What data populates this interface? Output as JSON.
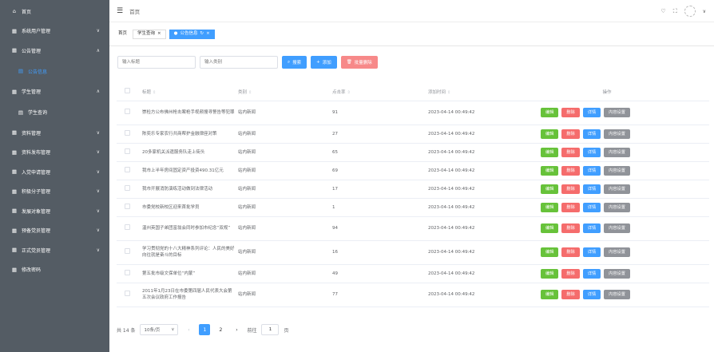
{
  "sidebar": {
    "items": [
      {
        "name": "sidebar-item-home",
        "icon": "⌂",
        "label": "首页",
        "chevron": ""
      },
      {
        "name": "sidebar-item-system-users",
        "icon": "▦",
        "label": "系统用户管理",
        "chevron": "∨"
      },
      {
        "name": "sidebar-item-notice-mgmt",
        "icon": "▦",
        "label": "公告管理",
        "chevron": "∧"
      },
      {
        "name": "sidebar-item-notice-info",
        "icon": "▤",
        "label": "公告信息",
        "chevron": "",
        "sub": true,
        "active": true
      },
      {
        "name": "sidebar-item-student-mgmt",
        "icon": "▦",
        "label": "学生管理",
        "chevron": "∧"
      },
      {
        "name": "sidebar-item-student-query",
        "icon": "▤",
        "label": "学生查询",
        "chevron": "",
        "sub": true
      },
      {
        "name": "sidebar-item-materials",
        "icon": "▦",
        "label": "资料管理",
        "chevron": "∨"
      },
      {
        "name": "sidebar-item-material-publish",
        "icon": "▦",
        "label": "资料发布管理",
        "chevron": "∨"
      },
      {
        "name": "sidebar-item-application",
        "icon": "▦",
        "label": "入党申请管理",
        "chevron": "∨"
      },
      {
        "name": "sidebar-item-activists",
        "icon": "▦",
        "label": "积极分子管理",
        "chevron": "∨"
      },
      {
        "name": "sidebar-item-development",
        "icon": "▦",
        "label": "发展对象管理",
        "chevron": "∨"
      },
      {
        "name": "sidebar-item-probationary",
        "icon": "▦",
        "label": "预备党员管理",
        "chevron": "∨"
      },
      {
        "name": "sidebar-item-full-members",
        "icon": "▦",
        "label": "正式党员管理",
        "chevron": "∨"
      },
      {
        "name": "sidebar-item-change-password",
        "icon": "▦",
        "label": "修改密码",
        "chevron": ""
      }
    ]
  },
  "topbar": {
    "breadcrumb": "首页",
    "hamburger_icon": "☰",
    "icons": [
      "bell-icon",
      "fullscreen-icon"
    ]
  },
  "tags": [
    {
      "label": "首页",
      "active": false,
      "closable": false
    },
    {
      "label": "学生查询",
      "active": false,
      "closable": true
    },
    {
      "label": "公告信息",
      "active": true,
      "closable": true
    }
  ],
  "filters": {
    "title_placeholder": "输入标题",
    "category_placeholder": "输入类别",
    "search_label": "搜索",
    "add_label": "添加",
    "batch_delete_label": "批量删除"
  },
  "table": {
    "headers": {
      "title": "标题",
      "category": "类别",
      "clicks": "点击率",
      "added_time": "添加时间",
      "actions": "操作"
    },
    "action_labels": {
      "edit": "编辑",
      "delete": "删除",
      "detail": "详情",
      "content": "内容设置"
    },
    "rows": [
      {
        "title": "崇检方公布佛州枪击案枪手视频搜寻警告等犯罪",
        "category": "站内新闻",
        "clicks": "91",
        "time": "2023-04-14 00:49:42",
        "tall": true
      },
      {
        "title": "陈奕乐专家农行共商帮护金融律座对策",
        "category": "站内新闻",
        "clicks": "27",
        "time": "2023-04-14 00:49:42",
        "tall": false
      },
      {
        "title": "20多家机关派遣服务队走上街头",
        "category": "站内新闻",
        "clicks": "65",
        "time": "2023-04-14 00:49:42",
        "tall": false
      },
      {
        "title": "我市上半年房间固定资产投资490.31亿元",
        "category": "站内新闻",
        "clicks": "69",
        "time": "2023-04-14 00:49:42",
        "tall": false
      },
      {
        "title": "我市开展消防演练活动做到法律活动",
        "category": "站内新闻",
        "clicks": "17",
        "time": "2023-04-14 00:49:42",
        "tall": false
      },
      {
        "title": "市委党校新校区迎来首批学员",
        "category": "站内新闻",
        "clicks": "1",
        "time": "2023-04-14 00:49:42",
        "tall": false
      },
      {
        "title": "温州英国子弟团富翁会同时参加市纪念“双规”",
        "category": "站内新闻",
        "clicks": "94",
        "time": "2023-04-14 00:49:42",
        "tall": true
      },
      {
        "title": "学习贯彻党的十八大精神系列评论：人民的美好向往就是奋斗的目标",
        "category": "站内新闻",
        "clicks": "16",
        "time": "2023-04-14 00:49:42",
        "tall": true
      },
      {
        "title": "第五批市级文保单位“内蒙”",
        "category": "站内新闻",
        "clicks": "49",
        "time": "2023-04-14 00:49:42",
        "tall": false
      },
      {
        "title": "2011年1月23日在市委第四届人民代表大会第五次会议政府工作报告",
        "category": "站内新闻",
        "clicks": "77",
        "time": "2023-04-14 00:49:42",
        "tall": true
      }
    ]
  },
  "pagination": {
    "total": "共 14 条",
    "page_size": "10条/页",
    "pages": [
      "1",
      "2"
    ],
    "current": "1",
    "goto_label": "前往",
    "goto_value": "1",
    "page_suffix": "页"
  },
  "colors": {
    "sidebar_bg": "#545c64",
    "primary": "#409eff",
    "success": "#67c23a",
    "danger": "#f56c6c",
    "info": "#909399"
  }
}
